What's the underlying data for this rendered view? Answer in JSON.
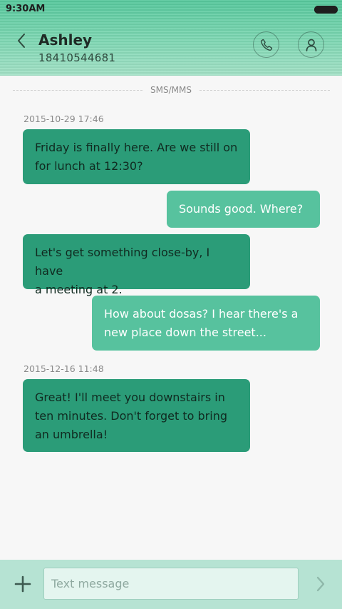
{
  "status_bar": {
    "time": "9:30AM"
  },
  "header": {
    "name": "Ashley",
    "phone": "18410544681",
    "icons": {
      "back": "chevron-left-icon",
      "call": "phone-icon",
      "profile": "person-icon"
    }
  },
  "conversation": {
    "channel_label": "SMS/MMS",
    "timestamps": [
      "2015-10-29 17:46",
      "2015-12-16 11:48"
    ],
    "messages": [
      {
        "direction": "incoming",
        "text": "Friday is finally here. Are we still on\nfor lunch at 12:30?"
      },
      {
        "direction": "outgoing",
        "text": "Sounds good. Where?"
      },
      {
        "direction": "incoming",
        "text": "Let's get something close-by, I have\na meeting at 2."
      },
      {
        "direction": "outgoing",
        "text": "How about dosas? I hear there's a\nnew place down the street..."
      },
      {
        "direction": "incoming",
        "text": "Great! I'll meet you downstairs in\nten minutes. Don't forget to bring\nan umbrella!"
      }
    ]
  },
  "composer": {
    "placeholder": "Text message",
    "value": "",
    "icons": {
      "attach": "plus-icon",
      "send": "chevron-right-icon"
    }
  },
  "colors": {
    "incoming_bubble": "#2b9c78",
    "outgoing_bubble": "#57c29e",
    "header": "#7fd7b3",
    "input_bar": "#b6e3d3"
  }
}
